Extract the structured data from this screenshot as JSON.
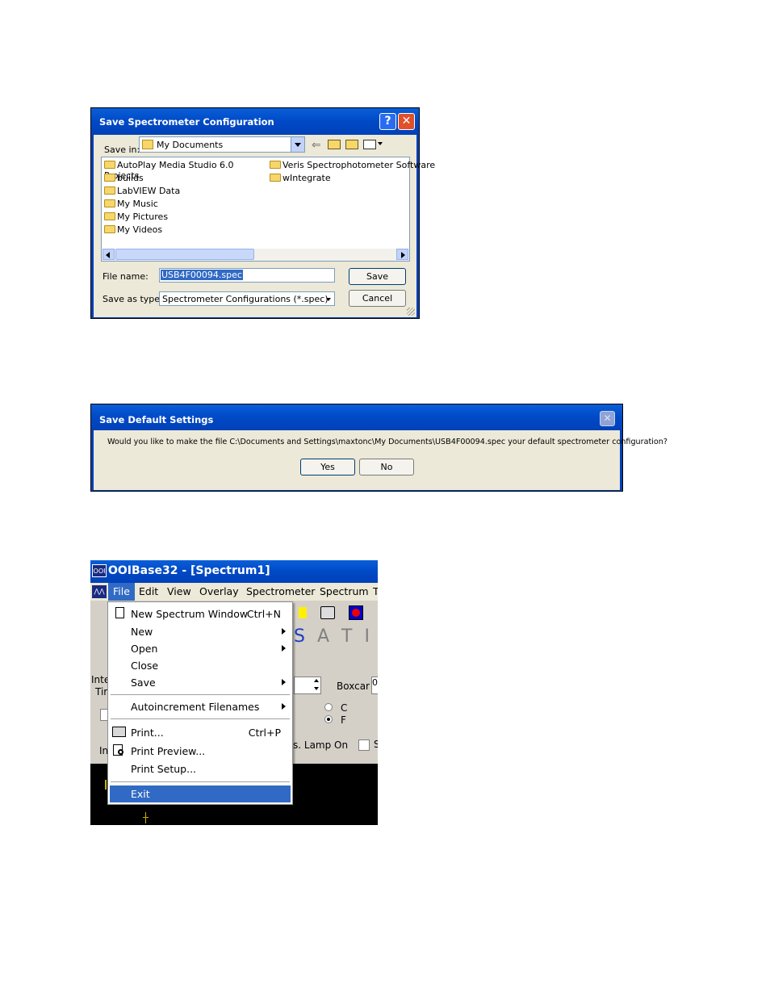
{
  "save_dialog": {
    "title": "Save Spectrometer Configuration",
    "help_icon": "help-icon",
    "close_icon": "close-icon",
    "save_in_label": "Save in:",
    "save_in_value": "My Documents",
    "files_col1": [
      {
        "name": "AutoPlay Media Studio 6.0 Projects",
        "icon": "folder-icon"
      },
      {
        "name": "builds",
        "icon": "folder-icon"
      },
      {
        "name": "LabVIEW Data",
        "icon": "folder-icon"
      },
      {
        "name": "My Music",
        "icon": "music-folder-icon"
      },
      {
        "name": "My Pictures",
        "icon": "pictures-folder-icon"
      },
      {
        "name": "My Videos",
        "icon": "folder-icon"
      }
    ],
    "files_col2": [
      {
        "name": "Veris Spectrophotometer Software",
        "icon": "folder-icon"
      },
      {
        "name": "wIntegrate",
        "icon": "folder-icon"
      }
    ],
    "file_name_label": "File name:",
    "file_name_value": "USB4F00094.spec",
    "save_as_type_label": "Save as type:",
    "save_as_type_value": "Spectrometer Configurations (*.spec)",
    "save_button": "Save",
    "cancel_button": "Cancel"
  },
  "default_dialog": {
    "title": "Save Default Settings",
    "message": "Would you like to make the file C:\\Documents and Settings\\maxtonc\\My Documents\\USB4F00094.spec your default spectrometer configuration?",
    "yes_button": "Yes",
    "no_button": "No"
  },
  "app": {
    "icon_label": "OOI",
    "title": "OOIBase32 - [Spectrum1]",
    "menus": [
      "File",
      "Edit",
      "View",
      "Overlay",
      "Spectrometer",
      "Spectrum",
      "T"
    ],
    "file_menu": {
      "new_spectrum_window": "New Spectrum Window",
      "new_spectrum_window_shortcut": "Ctrl+N",
      "new": "New",
      "open": "Open",
      "close": "Close",
      "save": "Save",
      "autoincrement": "Autoincrement Filenames",
      "print": "Print...",
      "print_shortcut": "Ctrl+P",
      "print_preview": "Print Preview...",
      "print_setup": "Print Setup...",
      "exit": "Exit"
    },
    "toolbar_letters": [
      "S",
      "A",
      "T",
      "I"
    ],
    "boxcar_label": "Boxcar",
    "boxcar_value": "0",
    "radio_c": "C",
    "radio_f": "F",
    "lamp_label": "s. Lamp On",
    "partial_inte": "Inte",
    "partial_tir": "Tir",
    "partial_in": "In",
    "partial_s": "S"
  }
}
